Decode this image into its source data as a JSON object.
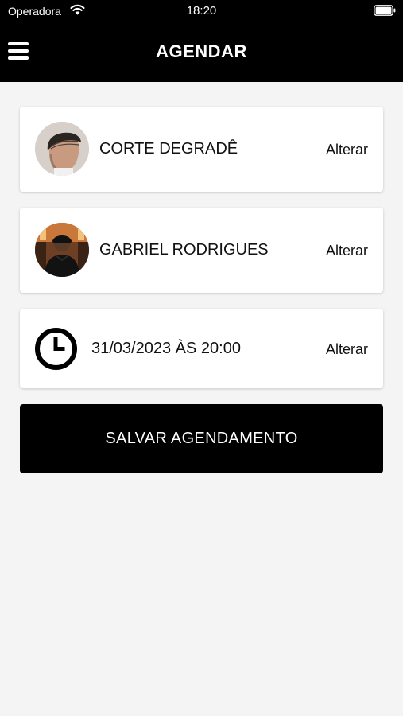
{
  "status_bar": {
    "carrier": "Operadora",
    "time": "18:20",
    "icons": [
      "wifi-icon",
      "battery-icon"
    ]
  },
  "header": {
    "title": "AGENDAR",
    "menu_icon": "hamburger-menu-icon",
    "background": "#000000"
  },
  "booking": {
    "service": {
      "label": "CORTE DEGRADÊ",
      "change_label": "Alterar",
      "image": "haircut-photo"
    },
    "barber": {
      "label": "GABRIEL RODRIGUES",
      "change_label": "Alterar",
      "image": "barber-photo"
    },
    "datetime": {
      "label": "31/03/2023 ÀS 20:00",
      "change_label": "Alterar",
      "icon": "clock-icon"
    }
  },
  "actions": {
    "save_label": "SALVAR AGENDAMENTO"
  },
  "colors": {
    "background": "#f4f4f4",
    "card": "#ffffff",
    "accent": "#000000",
    "text": "#111111"
  }
}
